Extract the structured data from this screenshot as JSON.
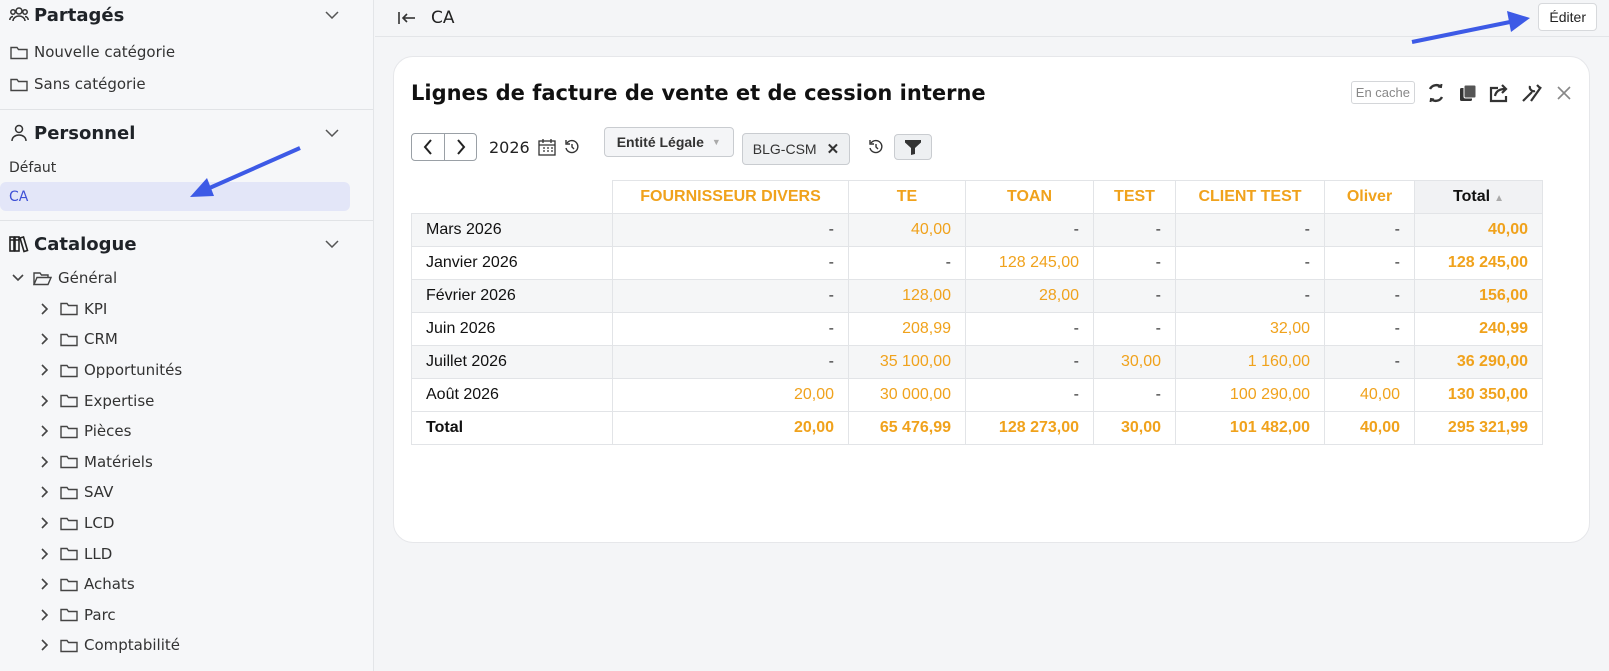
{
  "sidebar": {
    "shared": {
      "title": "Partagés",
      "items": [
        "Nouvelle catégorie",
        "Sans catégorie"
      ]
    },
    "personal": {
      "title": "Personnel",
      "items": [
        "Défaut",
        "CA"
      ]
    },
    "catalogue": {
      "title": "Catalogue",
      "root": "Général",
      "folders": [
        "KPI",
        "CRM",
        "Opportunités",
        "Expertise",
        "Pièces",
        "Matériels",
        "SAV",
        "LCD",
        "LLD",
        "Achats",
        "Parc",
        "Comptabilité"
      ]
    }
  },
  "topbar": {
    "breadcrumb": "CA",
    "edit_label": "Éditer"
  },
  "card": {
    "title": "Lignes de facture de vente et de cession interne",
    "cache_label": "En cache",
    "filters": {
      "year": "2026",
      "entity_label": "Entité Légale",
      "tag": "BLG-CSM"
    }
  },
  "table": {
    "columns": [
      "FOURNISSEUR DIVERS",
      "TE",
      "TOAN",
      "TEST",
      "CLIENT TEST",
      "Oliver",
      "Total"
    ],
    "rows": [
      {
        "label": "Mars 2026",
        "cells": [
          "-",
          "40,00",
          "-",
          "-",
          "-",
          "-",
          "40,00"
        ]
      },
      {
        "label": "Janvier 2026",
        "cells": [
          "-",
          "-",
          "128 245,00",
          "-",
          "-",
          "-",
          "128 245,00"
        ]
      },
      {
        "label": "Février 2026",
        "cells": [
          "-",
          "128,00",
          "28,00",
          "-",
          "-",
          "-",
          "156,00"
        ]
      },
      {
        "label": "Juin 2026",
        "cells": [
          "-",
          "208,99",
          "-",
          "-",
          "32,00",
          "-",
          "240,99"
        ]
      },
      {
        "label": "Juillet 2026",
        "cells": [
          "-",
          "35 100,00",
          "-",
          "30,00",
          "1 160,00",
          "-",
          "36 290,00"
        ]
      },
      {
        "label": "Août 2026",
        "cells": [
          "20,00",
          "30 000,00",
          "-",
          "-",
          "100 290,00",
          "40,00",
          "130 350,00"
        ]
      }
    ],
    "total_row": {
      "label": "Total",
      "cells": [
        "20,00",
        "65 476,99",
        "128 273,00",
        "30,00",
        "101 482,00",
        "40,00",
        "295 321,99"
      ]
    }
  },
  "colors": {
    "accent_orange": "#f0a21c",
    "active_blue": "#3f51d6",
    "arrow_blue": "#3d5ae6"
  }
}
